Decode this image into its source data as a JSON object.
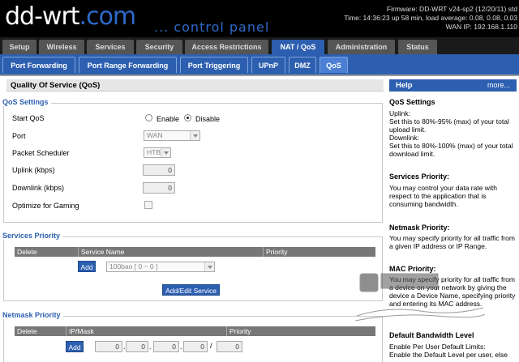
{
  "header": {
    "logo_main": "dd-wrt",
    "logo_com": ".com",
    "subtitle": "... control panel",
    "firmware": "Firmware: DD-WRT v24-sp2 (12/20/11) std",
    "time": "Time: 14:36:23 up 58 min, load average: 0.08, 0.08, 0.03",
    "wan_ip": "WAN IP: 192.168.1.110"
  },
  "main_tabs": [
    "Setup",
    "Wireless",
    "Services",
    "Security",
    "Access Restrictions",
    "NAT / QoS",
    "Administration",
    "Status"
  ],
  "sub_tabs": [
    "Port Forwarding",
    "Port Range Forwarding",
    "Port Triggering",
    "UPnP",
    "DMZ",
    "QoS"
  ],
  "page": {
    "title": "Quality Of Service (QoS)",
    "qos_settings": {
      "legend": "QoS Settings",
      "start_qos": "Start QoS",
      "enable": "Enable",
      "disable": "Disable",
      "port": "Port",
      "port_value": "WAN",
      "scheduler": "Packet Scheduler",
      "scheduler_value": "HTB",
      "uplink": "Uplink (kbps)",
      "uplink_value": "0",
      "downlink": "Downlink (kbps)",
      "downlink_value": "0",
      "gaming": "Optimize for Gaming"
    },
    "services_priority": {
      "legend": "Services Priority",
      "col_delete": "Delete",
      "col_service": "Service Name",
      "col_priority": "Priority",
      "add": "Add",
      "service_value": "100bao [ 0 ~ 0 ]",
      "add_edit": "Add/Edit Service"
    },
    "netmask_priority": {
      "legend": "Netmask Priority",
      "col_delete": "Delete",
      "col_ip": "IP/Mask",
      "col_priority": "Priority",
      "add": "Add",
      "ip1": "0",
      "ip2": "0",
      "ip3": "0",
      "ip4": "0",
      "mask": "0",
      "sep": ".",
      "slash": "/"
    }
  },
  "help": {
    "title": "Help",
    "more": "more...",
    "items": [
      {
        "title": "QoS Settings",
        "text": "Uplink:\nSet this to 80%-95% (max) of your total upload limit.\nDownlink:\nSet this to 80%-100% (max) of your total download limit."
      },
      {
        "title": "Services Priority:",
        "text": "You may control your data rate with respect to the application that is consuming bandwidth."
      },
      {
        "title": "Netmask Priority:",
        "text": "You may specify priority for all traffic from a given IP address or IP Range."
      },
      {
        "title": "MAC Priority:",
        "text": "You may specify priority for all traffic from a device on your network by giving the device a Device Name, specifying priority and entering its MAC address."
      },
      {
        "title": "Default Bandwidth Level",
        "text": "Enable Per User Default Limits:\nEnable the Default Level per user, else"
      }
    ]
  },
  "colors": {
    "accent": "#2d5fb0",
    "header_bg": "#000000",
    "tab_bg": "#555555"
  }
}
